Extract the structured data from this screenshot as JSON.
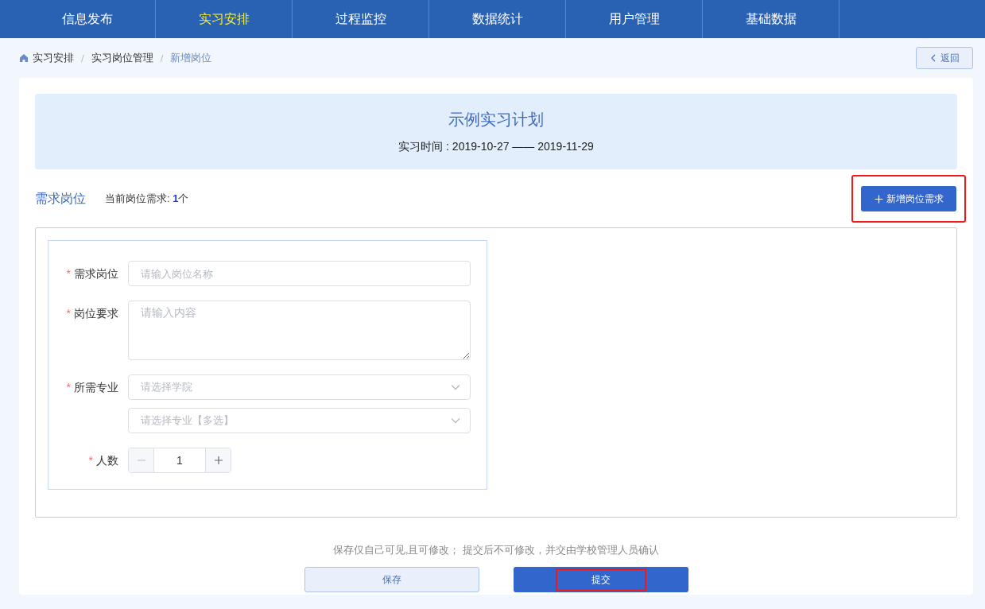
{
  "nav": {
    "items": [
      {
        "label": "信息发布",
        "selected": false
      },
      {
        "label": "实习安排",
        "selected": true
      },
      {
        "label": "过程监控",
        "selected": false
      },
      {
        "label": "数据统计",
        "selected": false
      },
      {
        "label": "用户管理",
        "selected": false
      },
      {
        "label": "基础数据",
        "selected": false
      }
    ]
  },
  "breadcrumb_separator": "/",
  "breadcrumb": [
    {
      "label": "实习安排",
      "current": false
    },
    {
      "label": "实习岗位管理",
      "current": false
    },
    {
      "label": "新增岗位",
      "current": true
    }
  ],
  "back_button": {
    "label": "返回"
  },
  "plan": {
    "title": "示例实习计划",
    "period": "实习时间 : 2019-10-27 —— 2019-11-29"
  },
  "section": {
    "title": "需求岗位",
    "count_label": "当前岗位需求: ",
    "count": "1",
    "count_unit": "个",
    "add_button": {
      "label": "新增岗位需求",
      "highlighted": true
    }
  },
  "form": {
    "required_mark": "*",
    "fields": [
      {
        "kind": "input",
        "label": "需求岗位",
        "required": true,
        "placeholder": "请输入岗位名称"
      },
      {
        "kind": "textarea",
        "label": "岗位要求",
        "required": true,
        "placeholder": "请输入内容"
      },
      {
        "kind": "select",
        "label": "所需专业",
        "required": true,
        "placeholder": "请选择学院"
      },
      {
        "kind": "select",
        "placeholder": "请选择专业【多选】"
      },
      {
        "kind": "counter",
        "label": "人数",
        "required": true,
        "value": "1"
      }
    ]
  },
  "footer": {
    "note": "保存仅自己可见,且可修改； 提交后不可修改，并交由学校管理人员确认",
    "buttons": [
      {
        "label": "保存",
        "kind": "secondary",
        "highlighted": false
      },
      {
        "label": "提交",
        "kind": "primary",
        "highlighted": true
      }
    ]
  }
}
